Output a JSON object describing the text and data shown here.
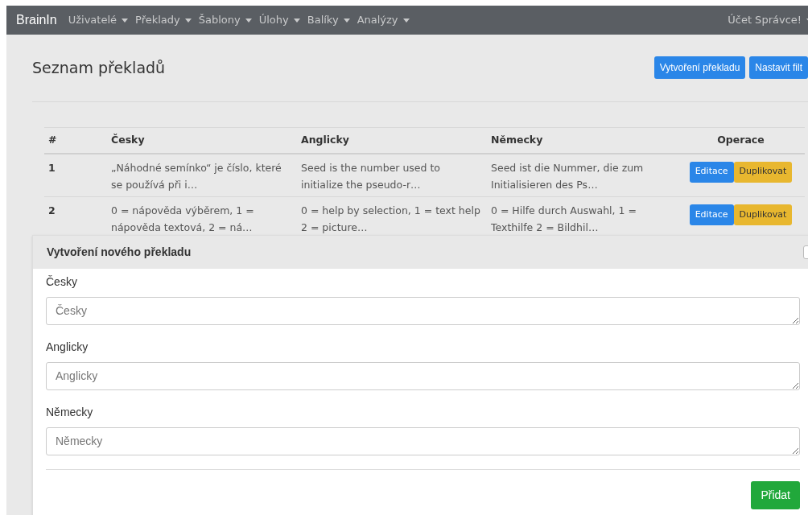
{
  "navbar": {
    "brand": "BrainIn",
    "menus": [
      {
        "label": "Uživatelé"
      },
      {
        "label": "Překlady"
      },
      {
        "label": "Šablony"
      },
      {
        "label": "Úlohy"
      },
      {
        "label": "Balíky"
      },
      {
        "label": "Analýzy"
      }
    ],
    "account": "Účet Správce!"
  },
  "page": {
    "title": "Seznam překladů",
    "buttons": [
      {
        "label": "Vytvoření překladu"
      },
      {
        "label": "Nastavit filt"
      }
    ]
  },
  "table": {
    "columns": [
      "#",
      "Česky",
      "Anglicky",
      "Německy",
      "Operace"
    ],
    "rows": [
      {
        "id": "1",
        "cs": "„Náhodné semínko“ je číslo, které se používá při i…",
        "en": "Seed is the number used to initialize the pseudo-r…",
        "de": "Seed ist die Nummer, die zum Initialisieren des Ps…",
        "actions": [
          "Editace",
          "Duplikovat"
        ]
      },
      {
        "id": "2",
        "cs": "0 = nápověda výběrem, 1 = nápověda textová, 2 = ná…",
        "en": "0 = help by selection, 1 = text help 2 = picture…",
        "de": "0 = Hilfe durch Auswahl, 1 = Texthilfe 2 = Bildhil…",
        "actions": [
          "Editace",
          "Duplikovat"
        ]
      }
    ]
  },
  "dialog": {
    "title": "Vytvoření nového překladu",
    "checked": false,
    "fields": [
      {
        "label": "Česky",
        "placeholder": "Česky"
      },
      {
        "label": "Anglicky",
        "placeholder": "Anglicky"
      },
      {
        "label": "Německy",
        "placeholder": "Německy"
      }
    ],
    "submit": "Přidat"
  }
}
